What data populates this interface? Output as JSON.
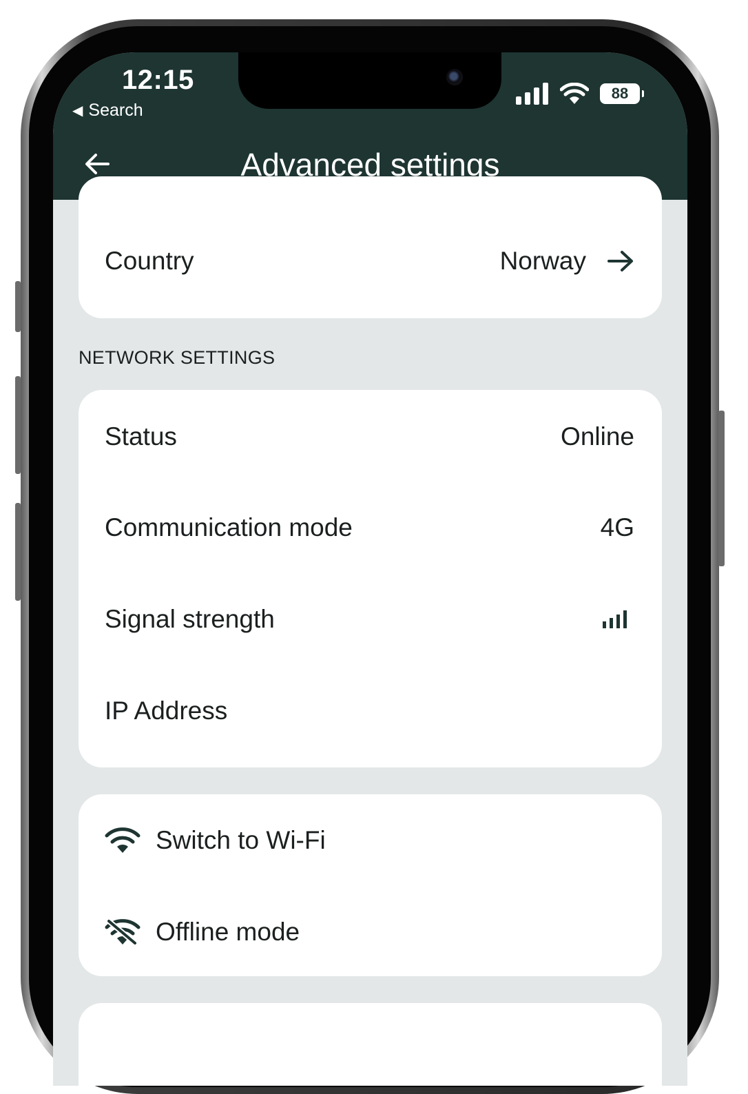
{
  "status_bar": {
    "time": "12:15",
    "back_app": "Search",
    "battery": "88",
    "icons": [
      "cellular-signal-icon",
      "wifi-icon",
      "battery-icon"
    ]
  },
  "header": {
    "title": "Advanced settings",
    "back_icon": "arrow-left-icon",
    "background": "#1e3532"
  },
  "country_row": {
    "label": "Country",
    "value": "Norway",
    "icon": "arrow-right-icon"
  },
  "network": {
    "section_label": "NETWORK SETTINGS",
    "status": {
      "label": "Status",
      "value": "Online"
    },
    "communication_mode": {
      "label": "Communication mode",
      "value": "4G"
    },
    "signal_strength": {
      "label": "Signal strength",
      "bars": 4,
      "max_bars": 4,
      "icon": "signal-bars-icon"
    },
    "ip_address": {
      "label": "IP Address",
      "value": ""
    }
  },
  "actions": {
    "switch_wifi": {
      "label": "Switch to Wi-Fi",
      "icon": "wifi-icon"
    },
    "offline_mode": {
      "label": "Offline mode",
      "icon": "wifi-off-icon"
    }
  },
  "colors": {
    "accent": "#1e3532",
    "background": "#e3e7e7",
    "card": "#ffffff",
    "text": "#1b1f1f"
  }
}
